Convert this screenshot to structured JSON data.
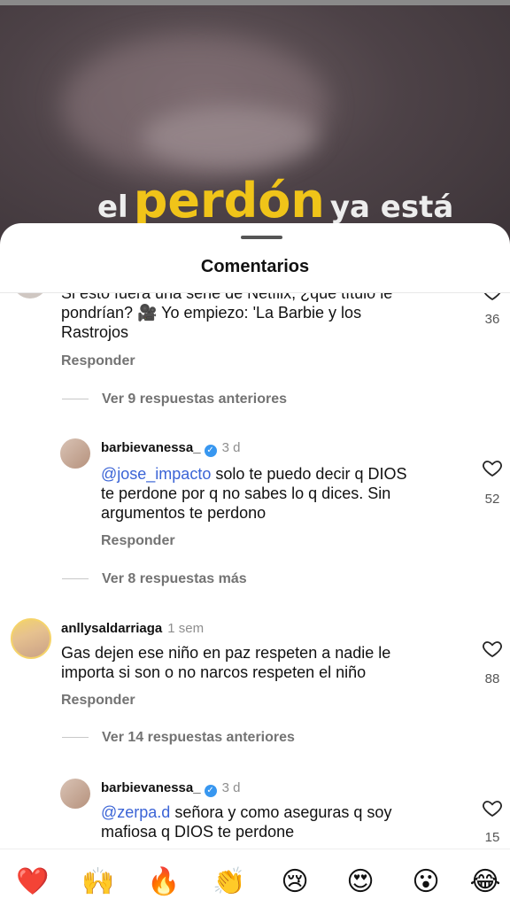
{
  "video": {
    "caption": [
      "el",
      "perdón",
      "ya está"
    ]
  },
  "sheet": {
    "title": "Comentarios"
  },
  "comment1": {
    "line1": "Si esto fuera una serie de Netflix, ¿qué título le",
    "line2": "pondrían? 🎥 Yo empiezo: 'La Barbie y los",
    "line3": "Rastrojos",
    "reply": "Responder",
    "likes": "36"
  },
  "more1": "Ver 9 respuestas anteriores",
  "reply1": {
    "user": "barbievanessa_",
    "time": "3 d",
    "mention": "@jose_impacto",
    "line1": " solo te puedo decir q DIOS",
    "line2": "te perdone por q no sabes lo q dices. Sin",
    "line3": "argumentos te perdono",
    "reply": "Responder",
    "likes": "52"
  },
  "more2": "Ver 8 respuestas más",
  "comment2": {
    "user": "anllysaldarriaga",
    "time": "1 sem",
    "line1": "Gas dejen ese niño en paz respeten a nadie le",
    "line2": "importa si son o no narcos respeten el niño",
    "reply": "Responder",
    "likes": "88"
  },
  "more3": "Ver 14 respuestas anteriores",
  "reply2": {
    "user": "barbievanessa_",
    "time": "3 d",
    "mention": "@zerpa.d",
    "line1": " señora y como aseguras q soy",
    "line2": "mafiosa q DIOS te perdone",
    "likes": "15"
  },
  "emojis": [
    "❤️",
    "🙌",
    "🔥",
    "👏",
    "😢",
    "😍",
    "😮",
    "😂"
  ],
  "colors": {
    "mention": "#3b64d6",
    "caption_highlight": "#f0c419",
    "verified": "#3897f0"
  }
}
